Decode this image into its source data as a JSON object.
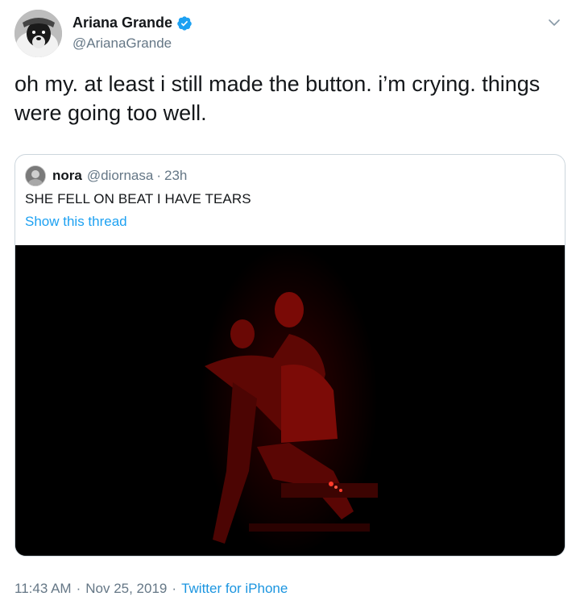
{
  "author": {
    "display_name": "Ariana Grande",
    "handle": "@ArianaGrande",
    "avatar_icon": "dog-avatar-icon",
    "verified_icon": "verified-badge-icon",
    "verified_color": "#1da1f2"
  },
  "tweet": {
    "text": "oh my. at least i still made the button. i’m crying. things were going too well."
  },
  "quoted": {
    "display_name": "nora",
    "handle": "@diornasa",
    "separator": "·",
    "time": "23h",
    "text": "SHE FELL ON BEAT I HAVE TEARS",
    "link_label": "Show this thread"
  },
  "meta": {
    "time": "11:43 AM",
    "sep1": "·",
    "date": "Nov 25, 2019",
    "sep2": "·",
    "source": "Twitter for iPhone"
  },
  "colors": {
    "link": "#1da1f2",
    "secondary_text": "#657786",
    "border": "#ccd6dd"
  }
}
